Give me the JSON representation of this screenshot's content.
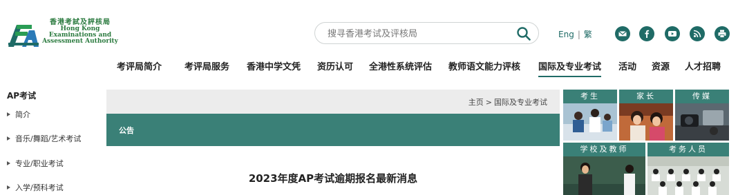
{
  "header": {
    "logo": {
      "chinese_name": "香港考試及評核局",
      "english_line1": "Hong Kong",
      "english_line2": "Examinations and",
      "english_line3": "Assessment Authority"
    },
    "search": {
      "placeholder": "搜寻香港考试及评核局"
    },
    "lang": {
      "english": "Eng",
      "separator": "|",
      "traditional": "繁"
    },
    "social_icons": [
      "email-icon",
      "facebook-icon",
      "youtube-icon",
      "rss-icon",
      "print-icon"
    ],
    "accent_color": "#1f6b66"
  },
  "nav": {
    "items": [
      {
        "label": "考评局简介"
      },
      {
        "label": "考评局服务"
      },
      {
        "label": "香港中学文凭"
      },
      {
        "label": "资历认可"
      },
      {
        "label": "全港性系统评估"
      },
      {
        "label": "教师语文能力评核"
      },
      {
        "label": "国际及专业考试"
      },
      {
        "label": "活动"
      },
      {
        "label": "资源"
      },
      {
        "label": "人才招聘"
      }
    ],
    "active": "国际及专业考试"
  },
  "sidebar": {
    "title": "AP考试",
    "items": [
      {
        "label": "简介"
      },
      {
        "label": "音乐/舞蹈/艺术考试"
      },
      {
        "label": "专业/职业考试"
      },
      {
        "label": "入学/预科考试"
      }
    ]
  },
  "main": {
    "breadcrumb": {
      "home": "主页",
      "separator": ">",
      "current": "国际及专业考试"
    },
    "notice_label": "公告",
    "article_title": "2023年度AP考试逾期报名最新消息"
  },
  "tiles": [
    {
      "label": "考生"
    },
    {
      "label": "家长"
    },
    {
      "label": "传媒"
    },
    {
      "label": "学校及教师"
    },
    {
      "label": "考务人员"
    }
  ]
}
